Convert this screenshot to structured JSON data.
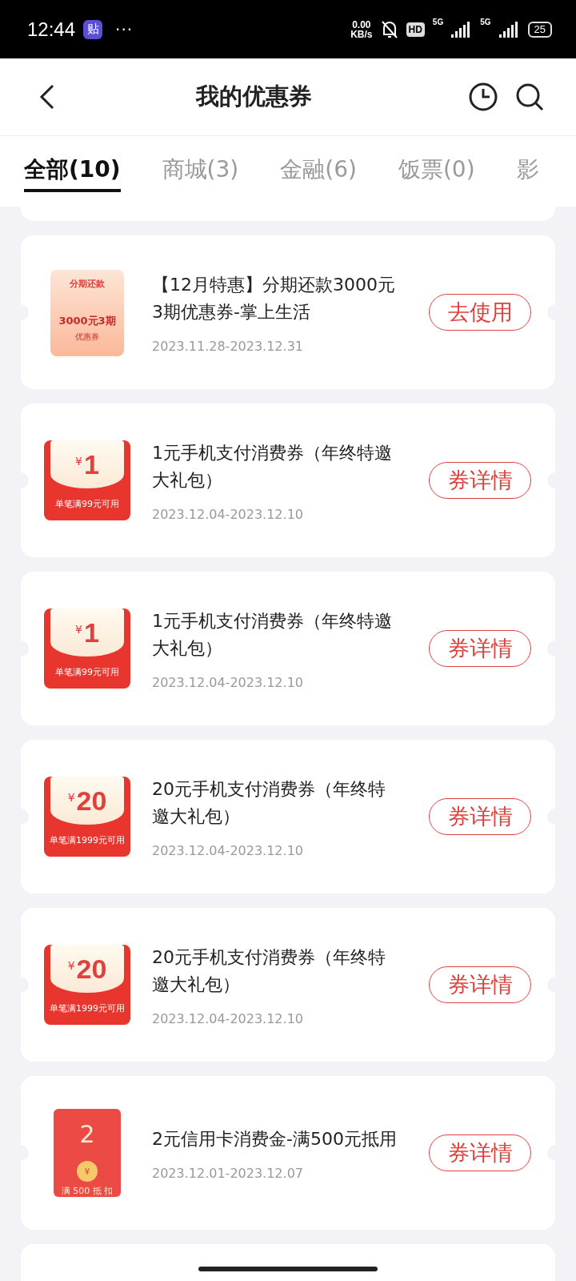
{
  "status_bar": {
    "time": "12:44",
    "app_badge": "贴",
    "more": "···",
    "net_speed": "0.00",
    "net_unit": "KB/s",
    "hd": "HD",
    "sim_labels": [
      "5G",
      "5G"
    ],
    "battery": "25"
  },
  "header": {
    "title": "我的优惠券"
  },
  "tabs": [
    {
      "label": "全部(10)",
      "selected": true
    },
    {
      "label": "商城(3)",
      "selected": false
    },
    {
      "label": "金融(6)",
      "selected": false
    },
    {
      "label": "饭票(0)",
      "selected": false
    },
    {
      "label": "影",
      "selected": false
    }
  ],
  "coupons": [
    {
      "art": {
        "kind": "ticket",
        "top": "分期还款",
        "main": "3000元3期",
        "sub": "优惠券"
      },
      "title": "【12月特惠】分期还款3000元3期优惠券-掌上生活",
      "date": "2023.11.28-2023.12.31",
      "action": "去使用"
    },
    {
      "art": {
        "kind": "redpacket",
        "currency": "¥",
        "main": "1",
        "sub": "单笔满99元可用"
      },
      "title": "1元手机支付消费券（年终特邀大礼包）",
      "date": "2023.12.04-2023.12.10",
      "action": "券详情"
    },
    {
      "art": {
        "kind": "redpacket",
        "currency": "¥",
        "main": "1",
        "sub": "单笔满99元可用"
      },
      "title": "1元手机支付消费券（年终特邀大礼包）",
      "date": "2023.12.04-2023.12.10",
      "action": "券详情"
    },
    {
      "art": {
        "kind": "redpacket",
        "currency": "¥",
        "main": "20",
        "sub": "单笔满1999元可用"
      },
      "title": "20元手机支付消费券（年终特邀大礼包）",
      "date": "2023.12.04-2023.12.10",
      "action": "券详情"
    },
    {
      "art": {
        "kind": "redpacket",
        "currency": "¥",
        "main": "20",
        "sub": "单笔满1999元可用"
      },
      "title": "20元手机支付消费券（年终特邀大礼包）",
      "date": "2023.12.04-2023.12.10",
      "action": "券详情"
    },
    {
      "art": {
        "kind": "envelope",
        "main": "2",
        "coin": "¥",
        "sub": "满 500 抵 扣"
      },
      "title": "2元信用卡消费金-满500元抵用",
      "date": "2023.12.01-2023.12.07",
      "action": "券详情"
    }
  ]
}
